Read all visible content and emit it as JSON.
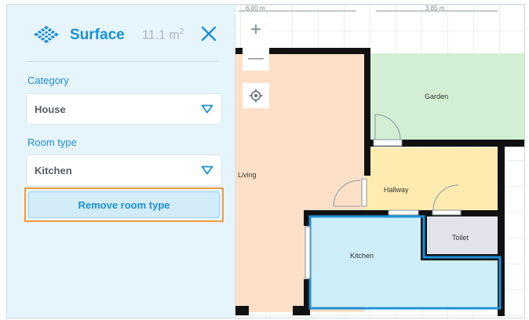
{
  "panel": {
    "title": "Surface",
    "area_value": "11.1 m",
    "area_unit_sup": "2",
    "category_label": "Category",
    "category_value": "House",
    "room_type_label": "Room type",
    "room_type_value": "Kitchen",
    "remove_button_label": "Remove room type"
  },
  "map": {
    "dimension_left": "6.00 m",
    "dimension_right": "3.85 m",
    "zoom_in_symbol": "+",
    "zoom_out_symbol": "—",
    "rooms": {
      "living": "Living",
      "garden": "Garden",
      "hallway": "Hallway",
      "kitchen": "Kitchen",
      "toilet": "Toilet"
    }
  },
  "colors": {
    "accent": "#1c8fd6",
    "highlight_outline": "#f39a3a",
    "panel_bg": "#e6f4fb",
    "living": "#fde0c8",
    "garden": "#d3efd3",
    "hallway": "#fdebb0",
    "kitchen": "#cdeef8",
    "toilet": "#e2e2ea"
  },
  "icons": [
    "logo-icon",
    "close-icon",
    "chevron-down-icon",
    "locate-icon",
    "zoom-in-icon",
    "zoom-out-icon"
  ]
}
